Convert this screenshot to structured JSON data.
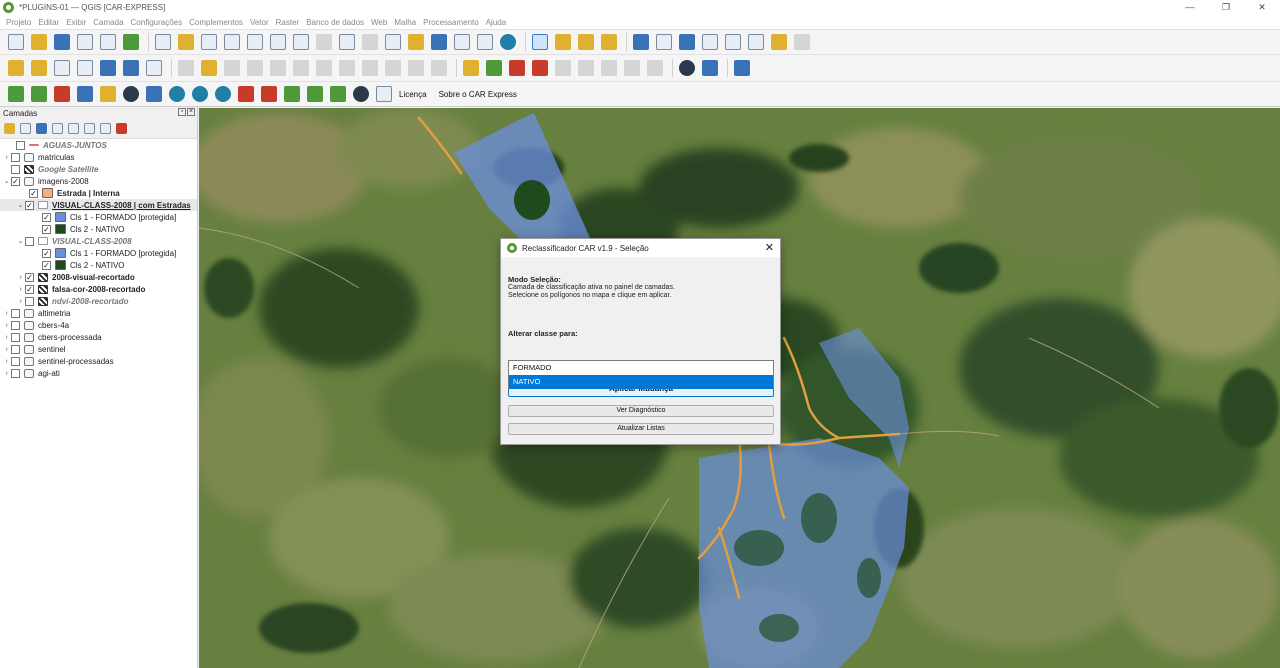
{
  "window": {
    "title": "*PLUGINS-01 — QGIS [CAR-EXPRESS]",
    "controls": [
      "—",
      "❐",
      "✕"
    ]
  },
  "menu": [
    "Projeto",
    "Editar",
    "Exibir",
    "Camada",
    "Configurações",
    "Complementos",
    "Vetor",
    "Raster",
    "Banco de dados",
    "Web",
    "Malha",
    "Processamento",
    "Ajuda"
  ],
  "plugin_toolbar": {
    "license": "Licença",
    "about": "Sobre o CAR Express"
  },
  "layers_panel": {
    "title": "Camadas",
    "layers": [
      {
        "label": "AGUAS-JUNTOS"
      },
      {
        "label": "matriculas"
      },
      {
        "label": "Google Satellite"
      },
      {
        "label": "imagens-2008"
      },
      {
        "label": "Estrada | Interna"
      },
      {
        "label": "VISUAL-CLASS-2008 | com Estradas"
      },
      {
        "label": "Cls 1 - FORMADO [protegida]"
      },
      {
        "label": "Cls 2 - NATIVO"
      },
      {
        "label": "VISUAL-CLASS-2008"
      },
      {
        "label": "Cls 1 - FORMADO [protegida]"
      },
      {
        "label": "Cls 2 - NATIVO"
      },
      {
        "label": "2008-visual-recortado"
      },
      {
        "label": "falsa-cor-2008-recortado"
      },
      {
        "label": "ndvi-2008-recortado"
      },
      {
        "label": "altimetria"
      },
      {
        "label": "cbers-4a"
      },
      {
        "label": "cbers-processada"
      },
      {
        "label": "sentinel"
      },
      {
        "label": "sentinel-processadas"
      },
      {
        "label": "agi-ati"
      }
    ]
  },
  "colors": {
    "formado": "#6b8fe0",
    "nativo": "#1e4a1e",
    "estrada": "#f0b080",
    "accent": "#0078d7"
  },
  "dialog": {
    "title": "Reclassificador CAR v1.9 - Seleção",
    "mode_title": "Modo Seleção:",
    "desc_line1": "Camada de classificação ativa no painel de camadas.",
    "desc_line2": "Selecione os polígonos no mapa e clique em aplicar.",
    "change_label": "Alterar classe para:",
    "options": [
      "FORMADO",
      "NATIVO"
    ],
    "highlighted_option": "NATIVO",
    "apply_button": "Aplicar Mudança",
    "diag_button": "Ver Diagnóstico",
    "update_button": "Atualizar Listas"
  }
}
